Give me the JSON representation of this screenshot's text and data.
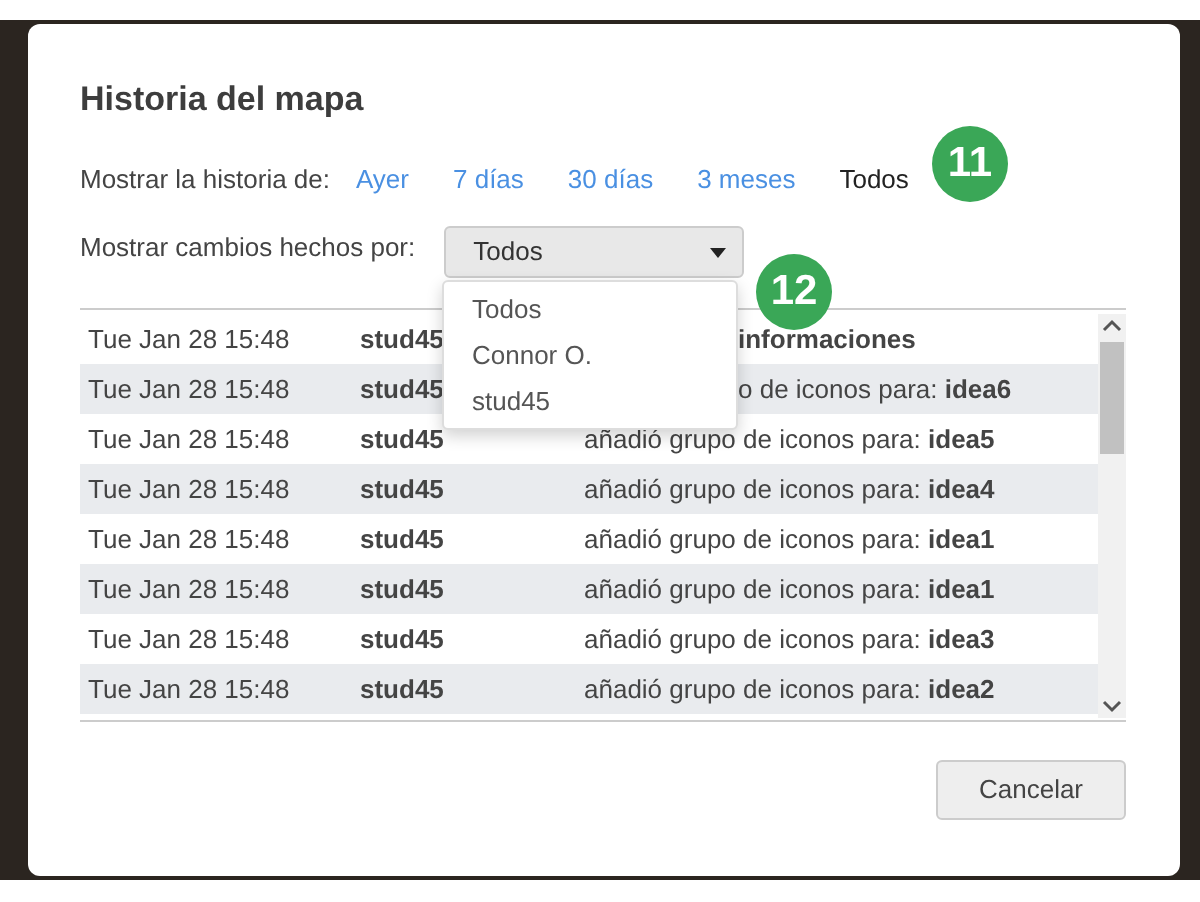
{
  "dialog": {
    "title": "Historia del mapa",
    "history_filter": {
      "label": "Mostrar la historia de:",
      "options": [
        {
          "label": "Ayer",
          "selected": false
        },
        {
          "label": "7 días",
          "selected": false
        },
        {
          "label": "30 días",
          "selected": false
        },
        {
          "label": "3 meses",
          "selected": false
        },
        {
          "label": "Todos",
          "selected": true
        }
      ]
    },
    "user_filter": {
      "label": "Mostrar cambios hechos por:",
      "value": "Todos",
      "menu": {
        "expanded": true,
        "items": [
          "Todos",
          "Connor O.",
          "stud45"
        ]
      }
    },
    "callouts": [
      "11",
      "12"
    ],
    "history": {
      "rows": [
        {
          "date": "Tue Jan 28 15:48",
          "user": "stud45",
          "change": "**informaciones**",
          "covered": true
        },
        {
          "date": "Tue Jan 28 15:48",
          "user": "stud45",
          "change": "o de iconos para: **idea6**",
          "covered": true
        },
        {
          "date": "Tue Jan 28 15:48",
          "user": "stud45",
          "change": "añadió grupo de iconos para: **idea5**",
          "covered": false
        },
        {
          "date": "Tue Jan 28 15:48",
          "user": "stud45",
          "change": "añadió grupo de iconos para: **idea4**",
          "covered": false
        },
        {
          "date": "Tue Jan 28 15:48",
          "user": "stud45",
          "change": "añadió grupo de iconos para: **idea1**",
          "covered": false
        },
        {
          "date": "Tue Jan 28 15:48",
          "user": "stud45",
          "change": "añadió grupo de iconos para: **idea1**",
          "covered": false
        },
        {
          "date": "Tue Jan 28 15:48",
          "user": "stud45",
          "change": "añadió grupo de iconos para: **idea3**",
          "covered": false
        },
        {
          "date": "Tue Jan 28 15:48",
          "user": "stud45",
          "change": "añadió grupo de iconos para: **idea2**",
          "covered": false
        }
      ]
    },
    "buttons": [
      "Cancelar"
    ]
  }
}
